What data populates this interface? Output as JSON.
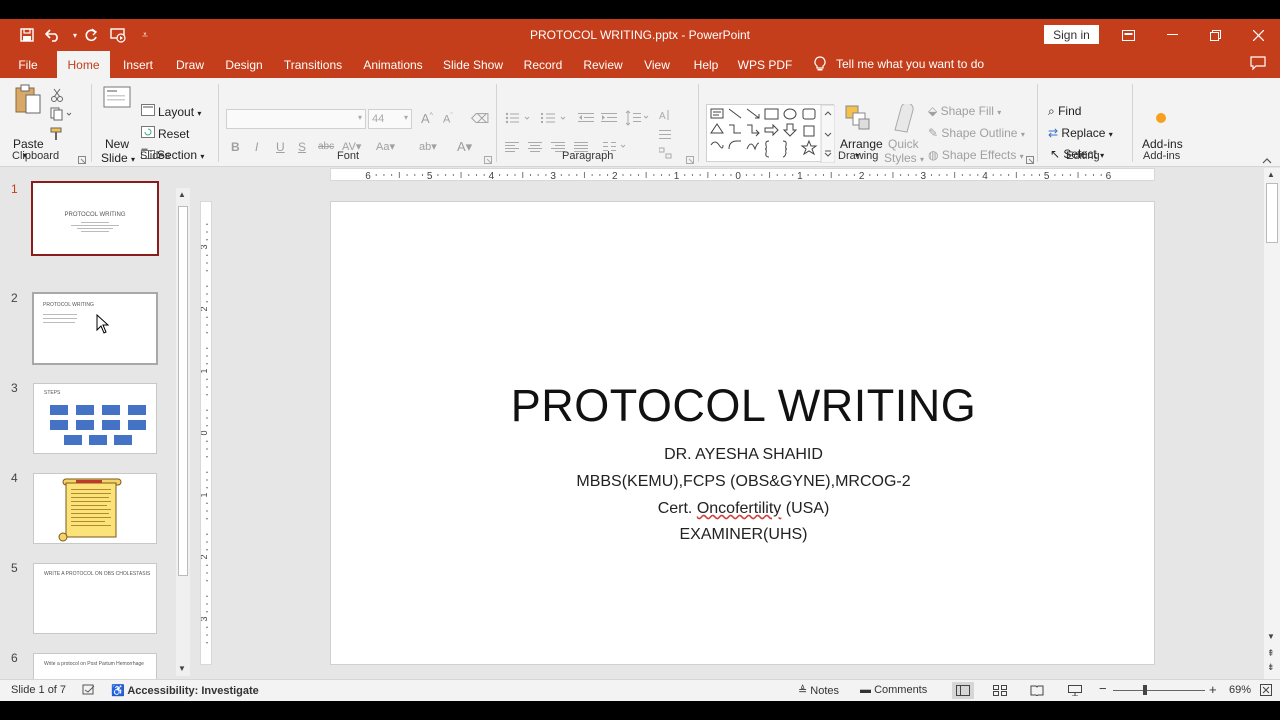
{
  "titlebar": {
    "document_title": "PROTOCOL WRITING.pptx  -  PowerPoint",
    "sign_in_label": "Sign in"
  },
  "tabs": [
    {
      "label": "File"
    },
    {
      "label": "Home"
    },
    {
      "label": "Insert"
    },
    {
      "label": "Draw"
    },
    {
      "label": "Design"
    },
    {
      "label": "Transitions"
    },
    {
      "label": "Animations"
    },
    {
      "label": "Slide Show"
    },
    {
      "label": "Record"
    },
    {
      "label": "Review"
    },
    {
      "label": "View"
    },
    {
      "label": "Help"
    },
    {
      "label": "WPS PDF"
    }
  ],
  "tell_me": "Tell me what you want to do",
  "ribbon": {
    "clipboard": {
      "paste": "Paste",
      "group": "Clipboard"
    },
    "slides": {
      "new_slide_1": "New",
      "new_slide_2": "Slide",
      "layout": "Layout",
      "reset": "Reset",
      "section": "Section",
      "group": "Slides"
    },
    "font": {
      "font_size": "44",
      "group": "Font"
    },
    "paragraph": {
      "group": "Paragraph"
    },
    "drawing": {
      "arrange": "Arrange",
      "quick_styles_1": "Quick",
      "quick_styles_2": "Styles",
      "shape_fill": "Shape Fill",
      "shape_outline": "Shape Outline",
      "shape_effects": "Shape Effects",
      "group": "Drawing"
    },
    "editing": {
      "find": "Find",
      "replace": "Replace",
      "select": "Select",
      "group": "Editing"
    },
    "addins": {
      "label": "Add-ins",
      "group": "Add-ins"
    }
  },
  "thumbnails": [
    {
      "num": "1",
      "title": "PROTOCOL WRITING"
    },
    {
      "num": "2",
      "title": "PROTOCOL WRITING"
    },
    {
      "num": "3",
      "title": "STEPS"
    },
    {
      "num": "4",
      "title": ""
    },
    {
      "num": "5",
      "title": "WRITE A PROTOCOL ON OBS CHOLESTASIS"
    },
    {
      "num": "6",
      "title": "Write a protocol on Post Partum Hemorrhage"
    }
  ],
  "ruler": {
    "horizontal": [
      "6",
      "5",
      "4",
      "3",
      "2",
      "1",
      "0",
      "1",
      "2",
      "3",
      "4",
      "5",
      "6"
    ],
    "vertical": [
      "3",
      "2",
      "1",
      "0",
      "1",
      "2",
      "3"
    ]
  },
  "slide": {
    "title": "PROTOCOL WRITING",
    "line1": "DR. AYESHA SHAHID",
    "line2": "MBBS(KEMU),FCPS (OBS&GYNE),MRCOG-2",
    "line3_prefix": "Cert. ",
    "line3_underlined": "Oncofertility",
    "line3_suffix": " (USA)",
    "line4": "EXAMINER(UHS)"
  },
  "status": {
    "slide_of": "Slide 1 of 7",
    "accessibility": "Accessibility: Investigate",
    "notes": "Notes",
    "comments": "Comments",
    "zoom": "69%"
  },
  "colors": {
    "accent": "#c43e1c",
    "selected_thumb_border": "#8b1c1c"
  }
}
